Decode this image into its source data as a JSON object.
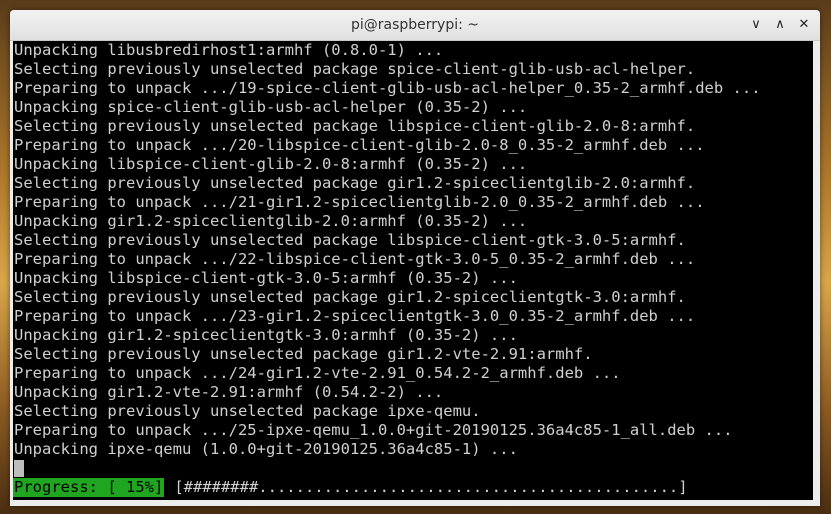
{
  "window": {
    "title": "pi@raspberrypi: ~",
    "controls": {
      "minimize": "∨",
      "maximize": "∧",
      "close": "✕"
    }
  },
  "terminal": {
    "lines": [
      "Unpacking libusbredirhost1:armhf (0.8.0-1) ...",
      "Selecting previously unselected package spice-client-glib-usb-acl-helper.",
      "Preparing to unpack .../19-spice-client-glib-usb-acl-helper_0.35-2_armhf.deb ...",
      "Unpacking spice-client-glib-usb-acl-helper (0.35-2) ...",
      "Selecting previously unselected package libspice-client-glib-2.0-8:armhf.",
      "Preparing to unpack .../20-libspice-client-glib-2.0-8_0.35-2_armhf.deb ...",
      "Unpacking libspice-client-glib-2.0-8:armhf (0.35-2) ...",
      "Selecting previously unselected package gir1.2-spiceclientglib-2.0:armhf.",
      "Preparing to unpack .../21-gir1.2-spiceclientglib-2.0_0.35-2_armhf.deb ...",
      "Unpacking gir1.2-spiceclientglib-2.0:armhf (0.35-2) ...",
      "Selecting previously unselected package libspice-client-gtk-3.0-5:armhf.",
      "Preparing to unpack .../22-libspice-client-gtk-3.0-5_0.35-2_armhf.deb ...",
      "Unpacking libspice-client-gtk-3.0-5:armhf (0.35-2) ...",
      "Selecting previously unselected package gir1.2-spiceclientgtk-3.0:armhf.",
      "Preparing to unpack .../23-gir1.2-spiceclientgtk-3.0_0.35-2_armhf.deb ...",
      "Unpacking gir1.2-spiceclientgtk-3.0:armhf (0.35-2) ...",
      "Selecting previously unselected package gir1.2-vte-2.91:armhf.",
      "Preparing to unpack .../24-gir1.2-vte-2.91_0.54.2-2_armhf.deb ...",
      "Unpacking gir1.2-vte-2.91:armhf (0.54.2-2) ...",
      "Selecting previously unselected package ipxe-qemu.",
      "Preparing to unpack .../25-ipxe-qemu_1.0.0+git-20190125.36a4c85-1_all.deb ...",
      "Unpacking ipxe-qemu (1.0.0+git-20190125.36a4c85-1) ..."
    ],
    "progress_label": "Progress: [ 15%]",
    "progress_bar": "[########.............................................]",
    "progress_value": 0.15
  },
  "colors": {
    "terminal_bg": "#000000",
    "terminal_fg": "#d0d0d0",
    "progress_bg": "#1fa51f"
  }
}
